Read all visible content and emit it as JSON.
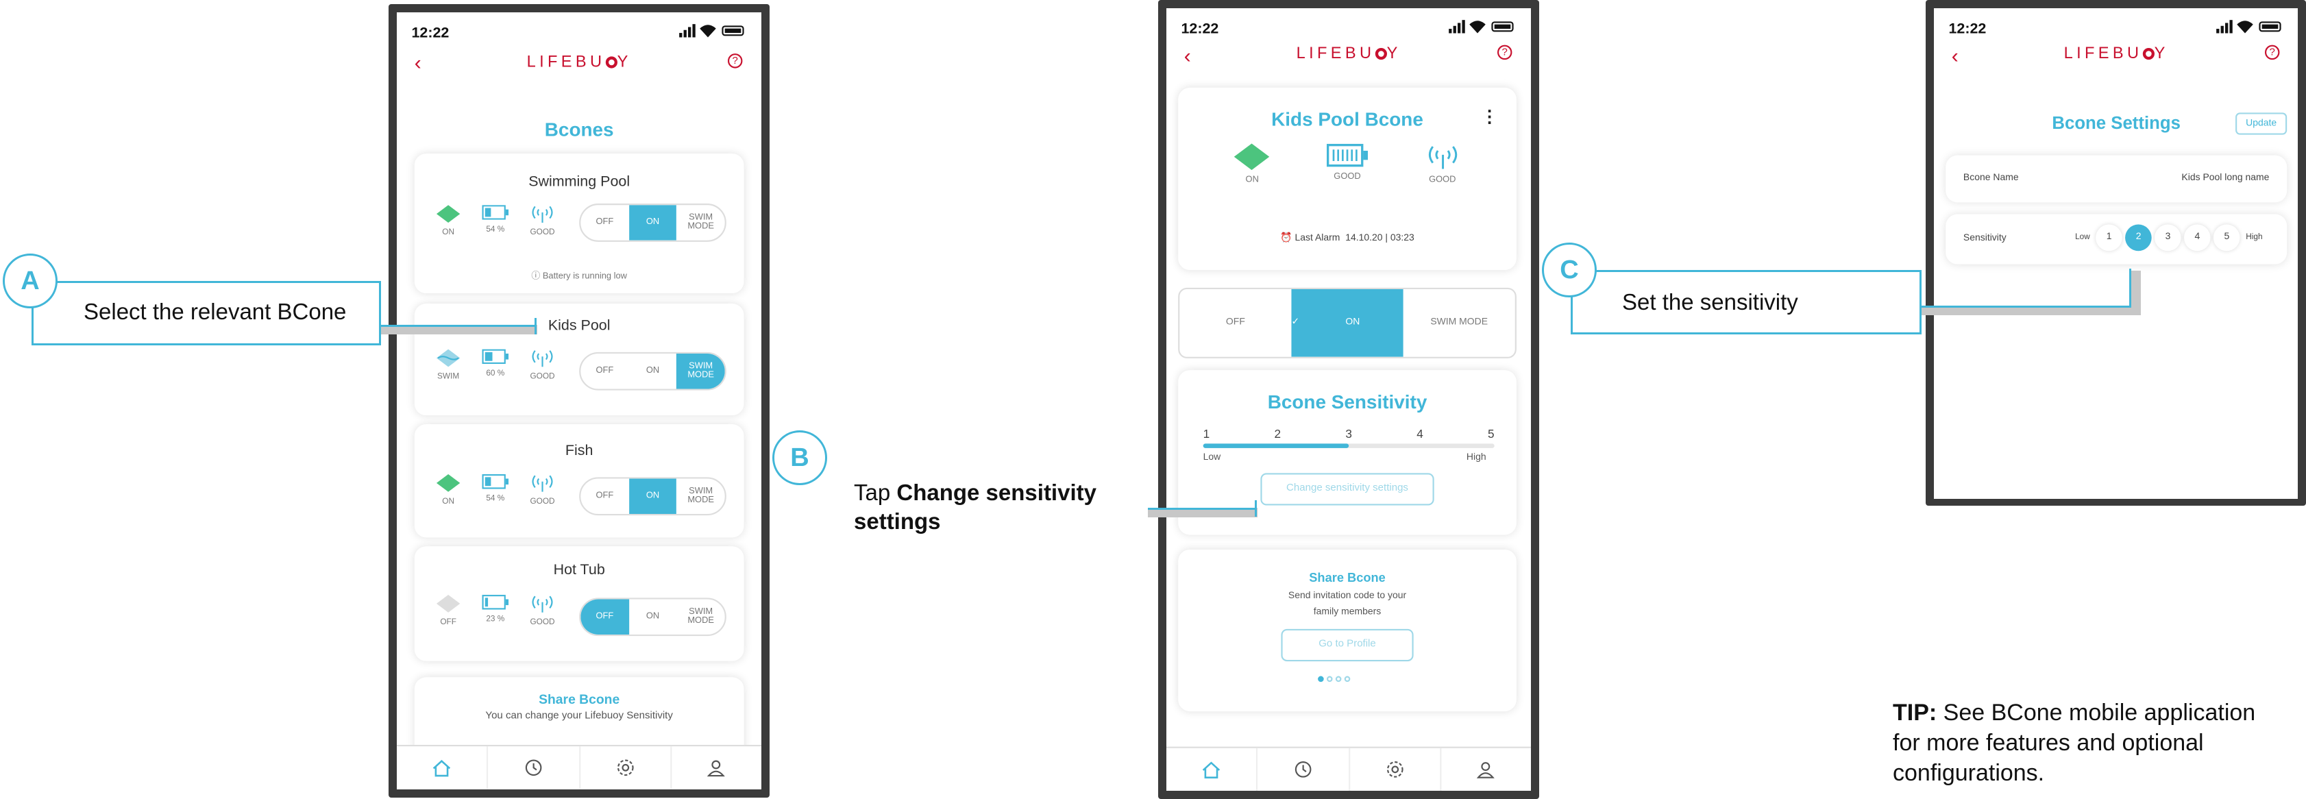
{
  "status_time": "12:22",
  "logo": "LIFEBU",
  "logo_end": "Y",
  "screen1": {
    "title": "Bcones",
    "items": [
      {
        "name": "Swimming Pool",
        "state": "ON",
        "battery": "54 %",
        "signal": "GOOD",
        "note": "Battery is running low",
        "selected": "ON"
      },
      {
        "name": "Kids Pool",
        "state": "SWIM",
        "battery": "60 %",
        "signal": "GOOD",
        "selected": "SWIM MODE"
      },
      {
        "name": "Fish",
        "state": "ON",
        "battery": "54 %",
        "signal": "GOOD",
        "selected": "ON"
      },
      {
        "name": "Hot Tub",
        "state": "OFF",
        "battery": "23 %",
        "signal": "GOOD",
        "selected": "OFF"
      }
    ],
    "toggle": {
      "off": "OFF",
      "on": "ON",
      "swim": "SWIM MODE"
    },
    "share_title": "Share Bcone",
    "share_text": "You can change your Lifebuoy Sensitivity"
  },
  "screen2": {
    "title": "Kids Pool Bcone",
    "state": "ON",
    "battery": "GOOD",
    "signal": "GOOD",
    "alarm_label": "Last Alarm",
    "alarm_value": "14.10.20 | 03:23",
    "toggle": {
      "off": "OFF",
      "on": "ON",
      "swim": "SWIM MODE"
    },
    "sens_title": "Bcone Sensitivity",
    "sens_values": [
      "1",
      "2",
      "3",
      "4",
      "5"
    ],
    "sens_level": 3,
    "sens_low": "Low",
    "sens_high": "High",
    "sens_button": "Change sensitivity settings",
    "share_title": "Share Bcone",
    "share_text1": "Send invitation code to your",
    "share_text2": "family members",
    "share_button": "Go to Profile"
  },
  "screen3": {
    "title": "Bcone Settings",
    "update": "Update",
    "name_label": "Bcone Name",
    "name_value": "Kids Pool long name",
    "sens_label": "Sensitivity",
    "low": "Low",
    "high": "High",
    "levels": [
      "1",
      "2",
      "3",
      "4",
      "5"
    ],
    "selected_level": "2"
  },
  "callouts": {
    "a_letter": "A",
    "a_text": "Select the relevant BCone",
    "b_letter": "B",
    "b_text1": "Tap ",
    "b_text_bold1": "Change sensitivity",
    "b_text_bold2": "settings",
    "c_letter": "C",
    "c_text": "Set the sensitivity"
  },
  "tip_label": "TIP:",
  "tip_text1": "See BCone mobile application",
  "tip_text2": "for more features and optional",
  "tip_text3": "configurations.",
  "colors": {
    "accent": "#41b6d8",
    "brand": "#c8102e",
    "green": "#4cc47e",
    "frame": "#3a3a3a"
  }
}
